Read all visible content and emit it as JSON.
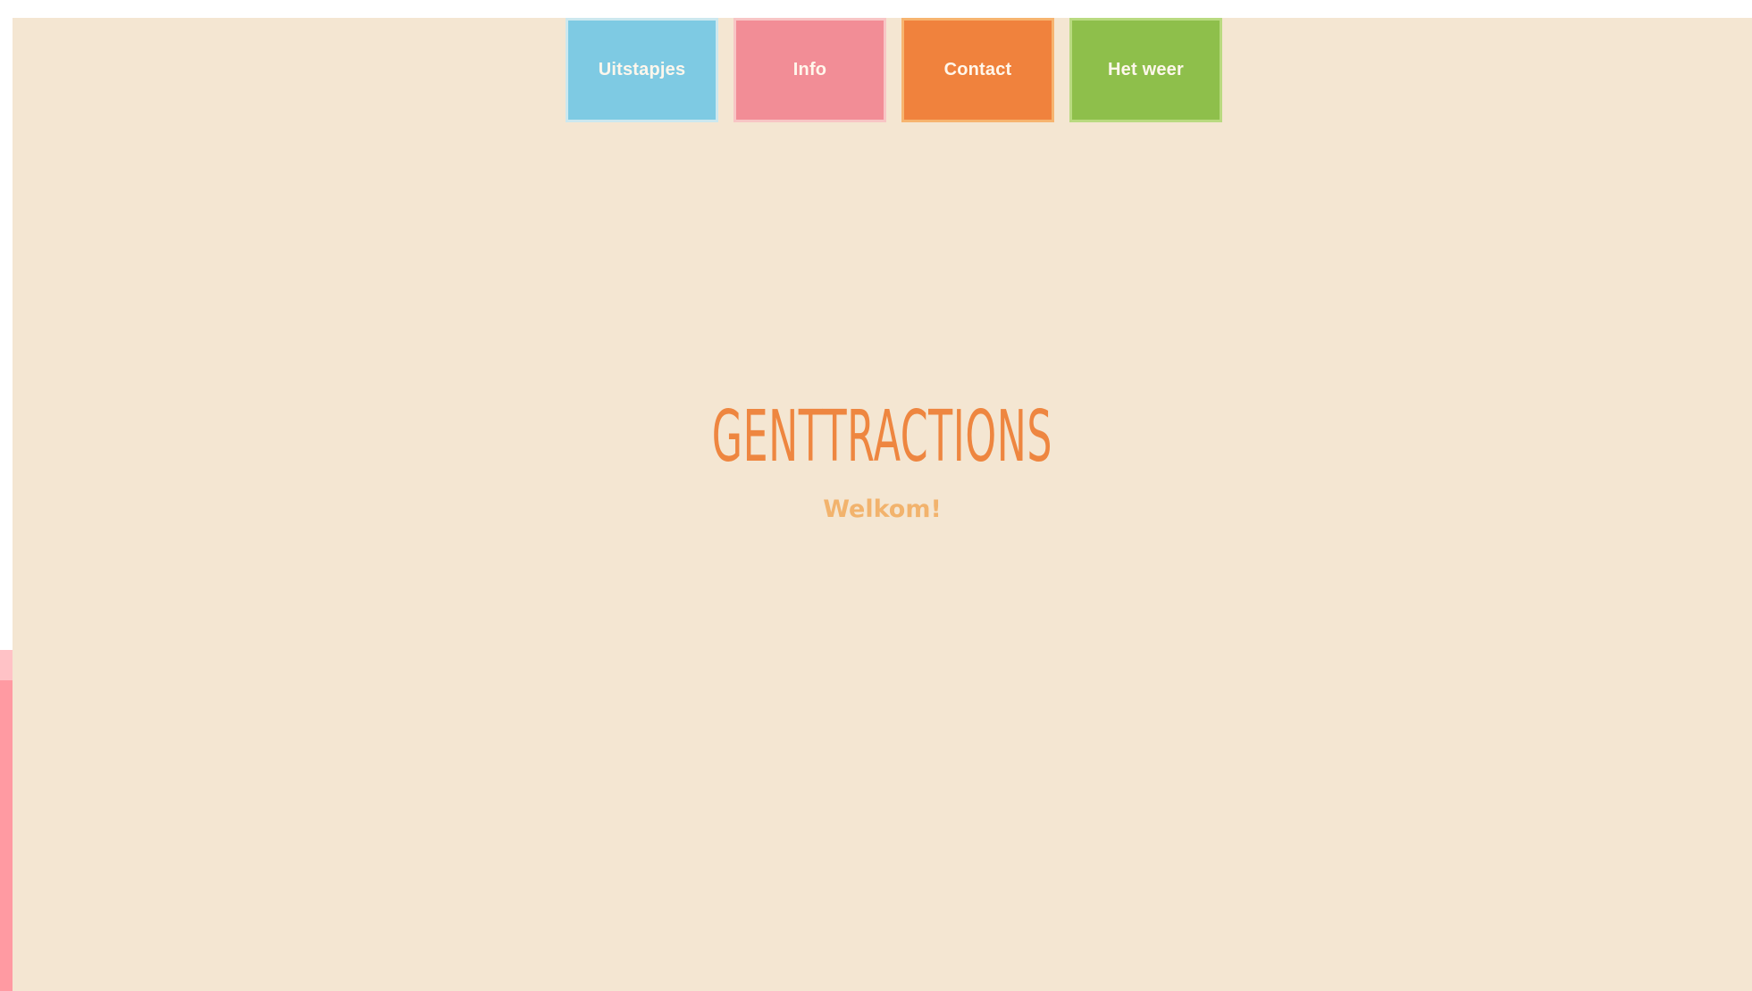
{
  "navigation": {
    "items": [
      {
        "label": "Uitstapjes",
        "color": "#7ecae3"
      },
      {
        "label": "Info",
        "color": "#f28d96"
      },
      {
        "label": "Contact",
        "color": "#f0823d"
      },
      {
        "label": "Het  weer",
        "color": "#8ebf4b"
      }
    ]
  },
  "hero": {
    "title": "GENTTRACTIONS",
    "subtitle": "Welkom!"
  },
  "colors": {
    "background": "#f4e6d2",
    "title": "#ee8640",
    "subtitle": "#f2b36d",
    "side_strip": "#ff9aa2"
  }
}
